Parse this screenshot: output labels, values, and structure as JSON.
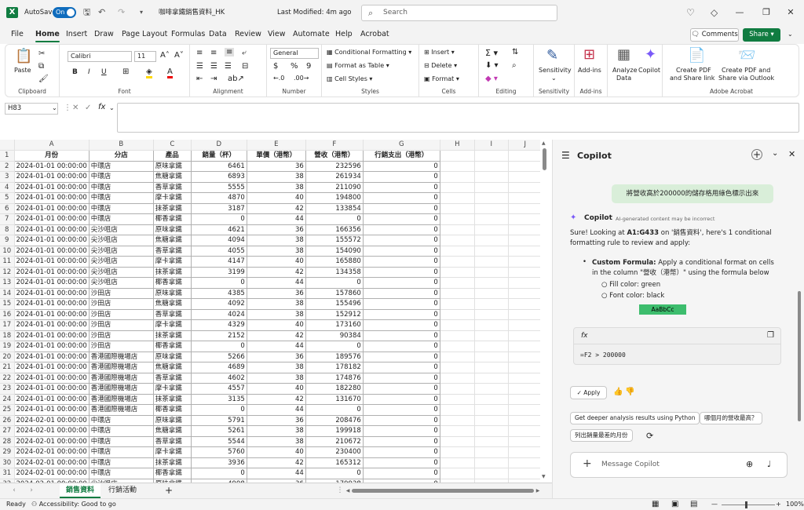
{
  "titlebar": {
    "autosave_label": "AutoSave",
    "autosave_state": "On",
    "filename": "咖啡拿鐵銷售資料_HK",
    "last_modified": "Last Modified: 4m ago",
    "search_placeholder": "Search"
  },
  "tabs": [
    "File",
    "Home",
    "Insert",
    "Draw",
    "Page Layout",
    "Formulas",
    "Data",
    "Review",
    "View",
    "Automate",
    "Help",
    "Acrobat"
  ],
  "active_tab": "Home",
  "comments_label": "Comments",
  "share_label": "Share",
  "ribbon": {
    "clipboard": {
      "paste": "Paste",
      "label": "Clipboard"
    },
    "font": {
      "name": "Calibri",
      "size": "11",
      "label": "Font"
    },
    "alignment": {
      "label": "Alignment"
    },
    "number": {
      "format": "General",
      "label": "Number"
    },
    "styles": {
      "cond": "Conditional Formatting",
      "table": "Format as Table",
      "cell": "Cell Styles",
      "label": "Styles"
    },
    "cells": {
      "insert": "Insert",
      "delete": "Delete",
      "format": "Format",
      "label": "Cells"
    },
    "editing": {
      "label": "Editing"
    },
    "sensitivity": {
      "btn": "Sensitivity",
      "label": "Sensitivity"
    },
    "addins": {
      "btn": "Add-ins",
      "label": "Add-ins"
    },
    "analyze": {
      "btn1": "Analyze",
      "btn2": "Data"
    },
    "copilot": {
      "btn": "Copilot"
    },
    "acrobat": {
      "b1a": "Create PDF",
      "b1b": "and Share link",
      "b2a": "Create PDF and",
      "b2b": "Share via Outlook",
      "label": "Adobe Acrobat"
    }
  },
  "formula": {
    "namebox": "H83",
    "fx": "fx",
    "value": ""
  },
  "grid": {
    "columns": [
      "A",
      "B",
      "C",
      "D",
      "E",
      "F",
      "G",
      "H",
      "I",
      "J"
    ],
    "headers": [
      "月份",
      "分店",
      "產品",
      "銷量（杯）",
      "單價（港幣）",
      "營收（港幣）",
      "行銷支出（港幣）"
    ],
    "rows": [
      [
        "2024-01-01 00:00:00",
        "中環店",
        "原味拿鐵",
        "6461",
        "36",
        "232596",
        "0"
      ],
      [
        "2024-01-01 00:00:00",
        "中環店",
        "焦糖拿鐵",
        "6893",
        "38",
        "261934",
        "0"
      ],
      [
        "2024-01-01 00:00:00",
        "中環店",
        "香草拿鐵",
        "5555",
        "38",
        "211090",
        "0"
      ],
      [
        "2024-01-01 00:00:00",
        "中環店",
        "摩卡拿鐵",
        "4870",
        "40",
        "194800",
        "0"
      ],
      [
        "2024-01-01 00:00:00",
        "中環店",
        "抹茶拿鐵",
        "3187",
        "42",
        "133854",
        "0"
      ],
      [
        "2024-01-01 00:00:00",
        "中環店",
        "椰香拿鐵",
        "0",
        "44",
        "0",
        "0"
      ],
      [
        "2024-01-01 00:00:00",
        "尖沙咀店",
        "原味拿鐵",
        "4621",
        "36",
        "166356",
        "0"
      ],
      [
        "2024-01-01 00:00:00",
        "尖沙咀店",
        "焦糖拿鐵",
        "4094",
        "38",
        "155572",
        "0"
      ],
      [
        "2024-01-01 00:00:00",
        "尖沙咀店",
        "香草拿鐵",
        "4055",
        "38",
        "154090",
        "0"
      ],
      [
        "2024-01-01 00:00:00",
        "尖沙咀店",
        "摩卡拿鐵",
        "4147",
        "40",
        "165880",
        "0"
      ],
      [
        "2024-01-01 00:00:00",
        "尖沙咀店",
        "抹茶拿鐵",
        "3199",
        "42",
        "134358",
        "0"
      ],
      [
        "2024-01-01 00:00:00",
        "尖沙咀店",
        "椰香拿鐵",
        "0",
        "44",
        "0",
        "0"
      ],
      [
        "2024-01-01 00:00:00",
        "沙田店",
        "原味拿鐵",
        "4385",
        "36",
        "157860",
        "0"
      ],
      [
        "2024-01-01 00:00:00",
        "沙田店",
        "焦糖拿鐵",
        "4092",
        "38",
        "155496",
        "0"
      ],
      [
        "2024-01-01 00:00:00",
        "沙田店",
        "香草拿鐵",
        "4024",
        "38",
        "152912",
        "0"
      ],
      [
        "2024-01-01 00:00:00",
        "沙田店",
        "摩卡拿鐵",
        "4329",
        "40",
        "173160",
        "0"
      ],
      [
        "2024-01-01 00:00:00",
        "沙田店",
        "抹茶拿鐵",
        "2152",
        "42",
        "90384",
        "0"
      ],
      [
        "2024-01-01 00:00:00",
        "沙田店",
        "椰香拿鐵",
        "0",
        "44",
        "0",
        "0"
      ],
      [
        "2024-01-01 00:00:00",
        "香港國際機場店",
        "原味拿鐵",
        "5266",
        "36",
        "189576",
        "0"
      ],
      [
        "2024-01-01 00:00:00",
        "香港國際機場店",
        "焦糖拿鐵",
        "4689",
        "38",
        "178182",
        "0"
      ],
      [
        "2024-01-01 00:00:00",
        "香港國際機場店",
        "香草拿鐵",
        "4602",
        "38",
        "174876",
        "0"
      ],
      [
        "2024-01-01 00:00:00",
        "香港國際機場店",
        "摩卡拿鐵",
        "4557",
        "40",
        "182280",
        "0"
      ],
      [
        "2024-01-01 00:00:00",
        "香港國際機場店",
        "抹茶拿鐵",
        "3135",
        "42",
        "131670",
        "0"
      ],
      [
        "2024-01-01 00:00:00",
        "香港國際機場店",
        "椰香拿鐵",
        "0",
        "44",
        "0",
        "0"
      ],
      [
        "2024-02-01 00:00:00",
        "中環店",
        "原味拿鐵",
        "5791",
        "36",
        "208476",
        "0"
      ],
      [
        "2024-02-01 00:00:00",
        "中環店",
        "焦糖拿鐵",
        "5261",
        "38",
        "199918",
        "0"
      ],
      [
        "2024-02-01 00:00:00",
        "中環店",
        "香草拿鐵",
        "5544",
        "38",
        "210672",
        "0"
      ],
      [
        "2024-02-01 00:00:00",
        "中環店",
        "摩卡拿鐵",
        "5760",
        "40",
        "230400",
        "0"
      ],
      [
        "2024-02-01 00:00:00",
        "中環店",
        "抹茶拿鐵",
        "3936",
        "42",
        "165312",
        "0"
      ],
      [
        "2024-02-01 00:00:00",
        "中環店",
        "椰香拿鐵",
        "0",
        "44",
        "0",
        "0"
      ],
      [
        "2024-02-01 00:00:00",
        "尖沙咀店",
        "原味拿鐵",
        "4998",
        "36",
        "179928",
        "0"
      ]
    ]
  },
  "sheets": [
    "銷售資料",
    "行銷活動"
  ],
  "active_sheet": "銷售資料",
  "status": {
    "ready": "Ready",
    "accessibility": "Accessibility: Good to go",
    "zoom": "100%"
  },
  "copilot": {
    "title": "Copilot",
    "user_msg": "將營收高於200000的儲存格用綠色標示出來",
    "name": "Copilot",
    "disclaimer": "AI-generated content may be incorrect",
    "intro_a": "Sure! Looking at ",
    "intro_range": "A1:G433",
    "intro_b": " on '銷售資料', here's 1 conditional formatting rule to review and apply:",
    "rule_title": "Custom Formula:",
    "rule_desc": " Apply a conditional format on cells in the column \"營收（港幣）\" using the formula below",
    "fill": "Fill color: green",
    "font": "Font color: black",
    "swatch": "AaBbCc",
    "fx": "fx",
    "formula": "=F2 > 200000",
    "apply": "Apply",
    "chip1": "Get deeper analysis results using Python",
    "chip2": "哪個月的營收最高？",
    "chip3": "列出銷量最差的月份",
    "message_placeholder": "Message Copilot"
  },
  "colors": {
    "excel_green": "#107c41",
    "accent_blue": "#0f6cbd",
    "swatch_green": "#3dbd6d"
  }
}
